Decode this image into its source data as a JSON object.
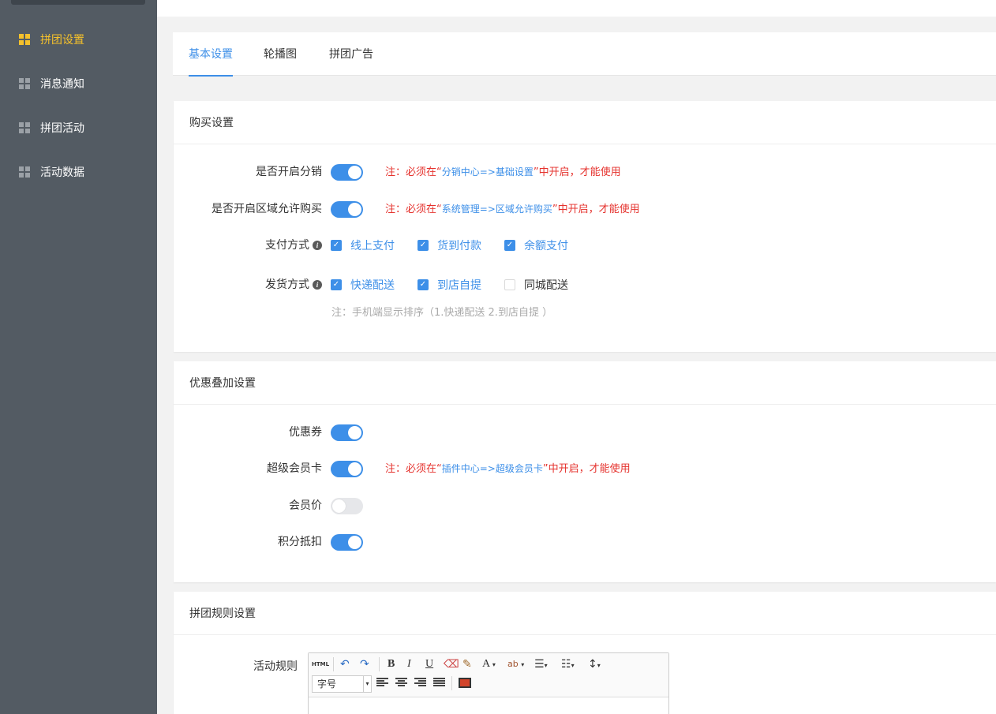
{
  "sidebar": {
    "items": [
      {
        "label": "拼团设置",
        "icon": "grid-icon",
        "active": true
      },
      {
        "label": "消息通知",
        "icon": "grid-icon",
        "active": false
      },
      {
        "label": "拼团活动",
        "icon": "grid-icon",
        "active": false
      },
      {
        "label": "活动数据",
        "icon": "grid-icon",
        "active": false
      }
    ]
  },
  "tabs": [
    {
      "label": "基本设置",
      "active": true
    },
    {
      "label": "轮播图",
      "active": false
    },
    {
      "label": "拼团广告",
      "active": false
    }
  ],
  "purchase": {
    "title": "购买设置",
    "distribution": {
      "label": "是否开启分销",
      "on": true,
      "note_pre": "注：必须在“",
      "note_link": "分销中心=>基础设置",
      "note_post": "”中开启，才能使用"
    },
    "region": {
      "label": "是否开启区域允许购买",
      "on": true,
      "note_pre": "注：必须在“",
      "note_link": "系统管理=>区域允许购买",
      "note_post": "”中开启，才能使用"
    },
    "payment": {
      "label": "支付方式",
      "options": [
        {
          "label": "线上支付",
          "checked": true
        },
        {
          "label": "货到付款",
          "checked": true
        },
        {
          "label": "余额支付",
          "checked": true
        }
      ]
    },
    "delivery": {
      "label": "发货方式",
      "options": [
        {
          "label": "快递配送",
          "checked": true
        },
        {
          "label": "到店自提",
          "checked": true
        },
        {
          "label": "同城配送",
          "checked": false
        }
      ],
      "note": "注：手机端显示排序（1.快递配送 2.到店自提 ）"
    }
  },
  "discount": {
    "title": "优惠叠加设置",
    "coupon": {
      "label": "优惠券",
      "on": true
    },
    "vip_card": {
      "label": "超级会员卡",
      "on": true,
      "note_pre": "注：必须在“",
      "note_link": "插件中心=>超级会员卡",
      "note_post": "”中开启，才能使用"
    },
    "member_price": {
      "label": "会员价",
      "on": false
    },
    "points": {
      "label": "积分抵扣",
      "on": true
    }
  },
  "rules": {
    "title": "拼团规则设置",
    "label": "活动规则",
    "editor": {
      "html_btn": "HTML",
      "font_size_placeholder": "字号",
      "bold": "B",
      "italic": "I",
      "underline": "U",
      "font_color": "A"
    }
  },
  "colors": {
    "accent": "#3d8fe8",
    "sidebar_bg": "#535b63",
    "active_nav": "#f5c12b",
    "warning": "#e5322d"
  }
}
